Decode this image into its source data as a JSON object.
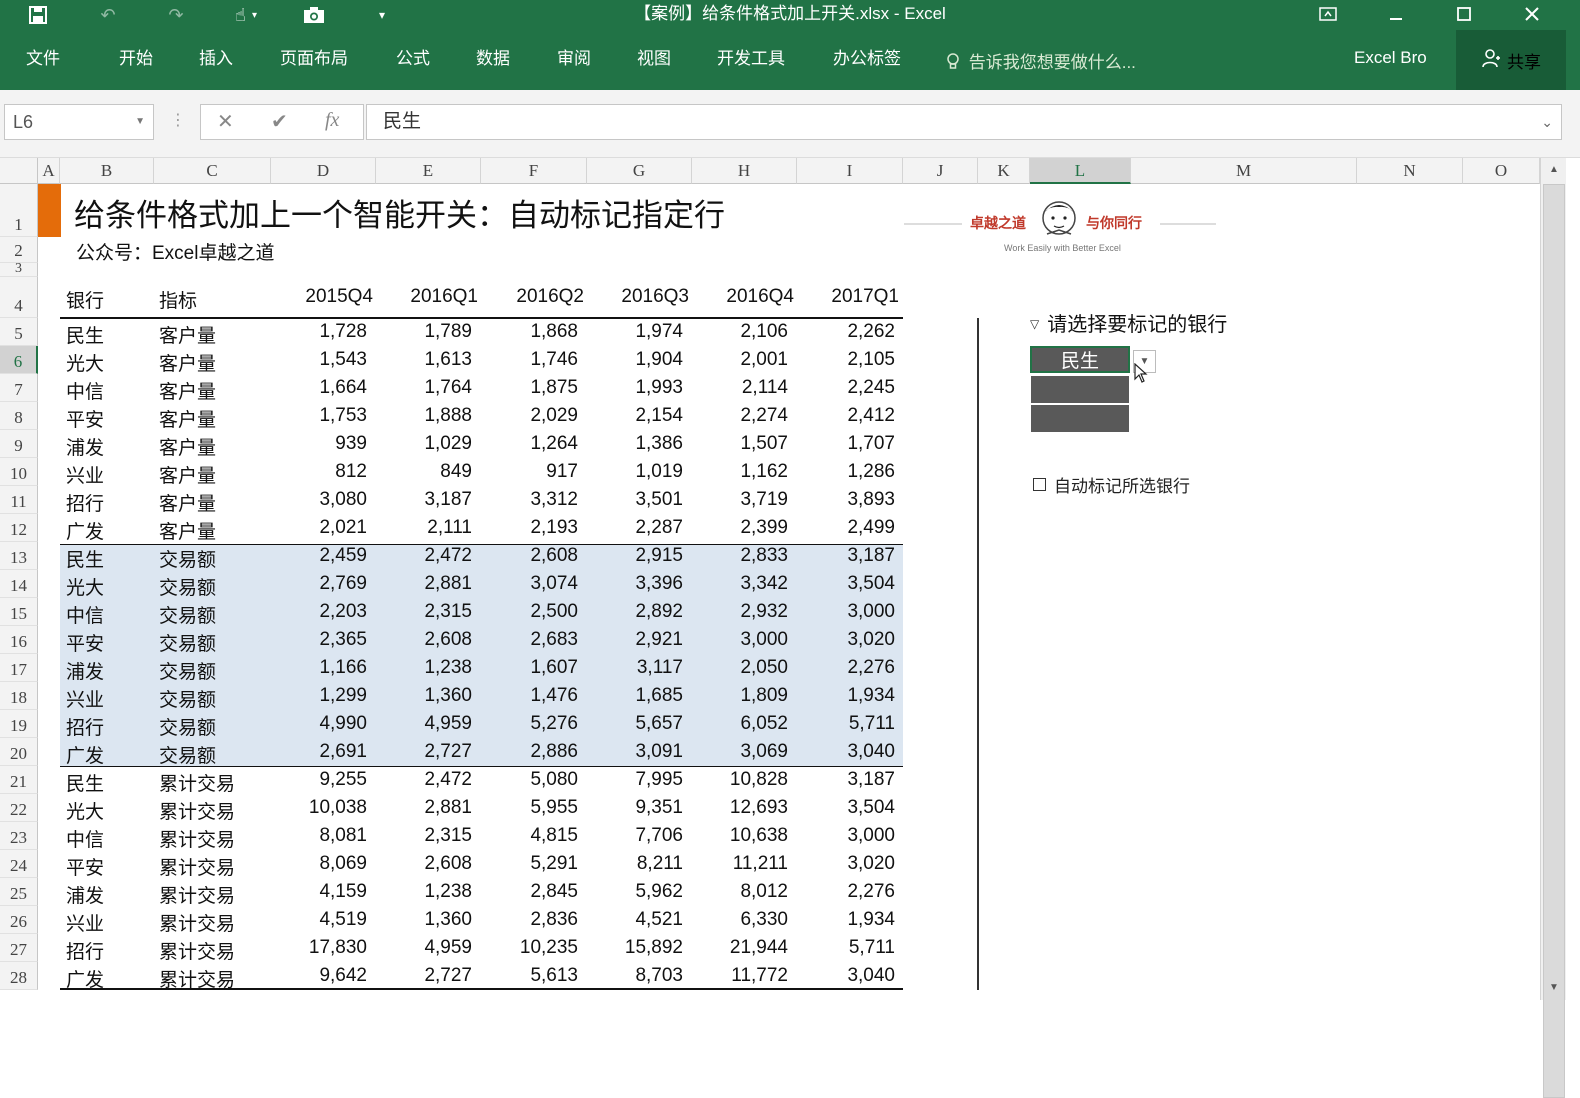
{
  "window": {
    "title": "【案例】给条件格式加上开关.xlsx - Excel",
    "qat_icons": [
      "save-icon",
      "undo-icon",
      "redo-icon",
      "touch-mode-icon",
      "camera-icon",
      "customize-qat-icon"
    ],
    "controls_icons": [
      "ribbon-display-icon",
      "minimize-icon",
      "maximize-icon",
      "close-icon"
    ]
  },
  "ribbon": {
    "tabs": [
      "文件",
      "开始",
      "插入",
      "页面布局",
      "公式",
      "数据",
      "审阅",
      "视图",
      "开发工具",
      "办公标签"
    ],
    "tell_me": "告诉我您想要做什么...",
    "user": "Excel Bro",
    "share": "共享"
  },
  "formula_bar": {
    "name_box": "L6",
    "value": "民生"
  },
  "grid": {
    "columns": [
      "A",
      "B",
      "C",
      "D",
      "E",
      "F",
      "G",
      "H",
      "I",
      "J",
      "K",
      "L",
      "M",
      "N",
      "O"
    ],
    "selected_column": "L",
    "rows": [
      "1",
      "2",
      "3",
      "4",
      "5",
      "6",
      "7",
      "8",
      "9",
      "10",
      "11",
      "12",
      "13",
      "14",
      "15",
      "16",
      "17",
      "18",
      "19",
      "20",
      "21",
      "22",
      "23",
      "24",
      "25",
      "26",
      "27",
      "28"
    ],
    "selected_row": "6"
  },
  "sheet": {
    "title": "给条件格式加上一个智能开关：自动标记指定行",
    "subtitle": "公众号：Excel卓越之道",
    "headers": [
      "银行",
      "指标",
      "2015Q4",
      "2016Q1",
      "2016Q2",
      "2016Q3",
      "2016Q4",
      "2017Q1"
    ],
    "rows": [
      [
        "民生",
        "客户量",
        "1,728",
        "1,789",
        "1,868",
        "1,974",
        "2,106",
        "2,262"
      ],
      [
        "光大",
        "客户量",
        "1,543",
        "1,613",
        "1,746",
        "1,904",
        "2,001",
        "2,105"
      ],
      [
        "中信",
        "客户量",
        "1,664",
        "1,764",
        "1,875",
        "1,993",
        "2,114",
        "2,245"
      ],
      [
        "平安",
        "客户量",
        "1,753",
        "1,888",
        "2,029",
        "2,154",
        "2,274",
        "2,412"
      ],
      [
        "浦发",
        "客户量",
        "939",
        "1,029",
        "1,264",
        "1,386",
        "1,507",
        "1,707"
      ],
      [
        "兴业",
        "客户量",
        "812",
        "849",
        "917",
        "1,019",
        "1,162",
        "1,286"
      ],
      [
        "招行",
        "客户量",
        "3,080",
        "3,187",
        "3,312",
        "3,501",
        "3,719",
        "3,893"
      ],
      [
        "广发",
        "客户量",
        "2,021",
        "2,111",
        "2,193",
        "2,287",
        "2,399",
        "2,499"
      ],
      [
        "民生",
        "交易额",
        "2,459",
        "2,472",
        "2,608",
        "2,915",
        "2,833",
        "3,187"
      ],
      [
        "光大",
        "交易额",
        "2,769",
        "2,881",
        "3,074",
        "3,396",
        "3,342",
        "3,504"
      ],
      [
        "中信",
        "交易额",
        "2,203",
        "2,315",
        "2,500",
        "2,892",
        "2,932",
        "3,000"
      ],
      [
        "平安",
        "交易额",
        "2,365",
        "2,608",
        "2,683",
        "2,921",
        "3,000",
        "3,020"
      ],
      [
        "浦发",
        "交易额",
        "1,166",
        "1,238",
        "1,607",
        "3,117",
        "2,050",
        "2,276"
      ],
      [
        "兴业",
        "交易额",
        "1,299",
        "1,360",
        "1,476",
        "1,685",
        "1,809",
        "1,934"
      ],
      [
        "招行",
        "交易额",
        "4,990",
        "4,959",
        "5,276",
        "5,657",
        "6,052",
        "5,711"
      ],
      [
        "广发",
        "交易额",
        "2,691",
        "2,727",
        "2,886",
        "3,091",
        "3,069",
        "3,040"
      ],
      [
        "民生",
        "累计交易",
        "9,255",
        "2,472",
        "5,080",
        "7,995",
        "10,828",
        "3,187"
      ],
      [
        "光大",
        "累计交易",
        "10,038",
        "2,881",
        "5,955",
        "9,351",
        "12,693",
        "3,504"
      ],
      [
        "中信",
        "累计交易",
        "8,081",
        "2,315",
        "4,815",
        "7,706",
        "10,638",
        "3,000"
      ],
      [
        "平安",
        "累计交易",
        "8,069",
        "2,608",
        "5,291",
        "8,211",
        "11,211",
        "3,020"
      ],
      [
        "浦发",
        "累计交易",
        "4,159",
        "1,238",
        "2,845",
        "5,962",
        "8,012",
        "2,276"
      ],
      [
        "兴业",
        "累计交易",
        "4,519",
        "1,360",
        "2,836",
        "4,521",
        "6,330",
        "1,934"
      ],
      [
        "招行",
        "累计交易",
        "17,830",
        "4,959",
        "10,235",
        "15,892",
        "21,944",
        "5,711"
      ],
      [
        "广发",
        "累计交易",
        "9,642",
        "2,727",
        "5,613",
        "8,703",
        "11,772",
        "3,040"
      ]
    ],
    "highlight_color": "#dce6f1",
    "accent_color": "#e46c0a"
  },
  "logo": {
    "left_text": "卓越之道",
    "right_text": "与你同行",
    "tagline": "Work Easily with Better Excel"
  },
  "selector": {
    "title": "请选择要标记的银行",
    "selected": "民生",
    "checkbox_label": "自动标记所选银行",
    "checkbox_checked": false
  },
  "theme": {
    "excel_green": "#217346",
    "slicer_gray": "#595959"
  }
}
